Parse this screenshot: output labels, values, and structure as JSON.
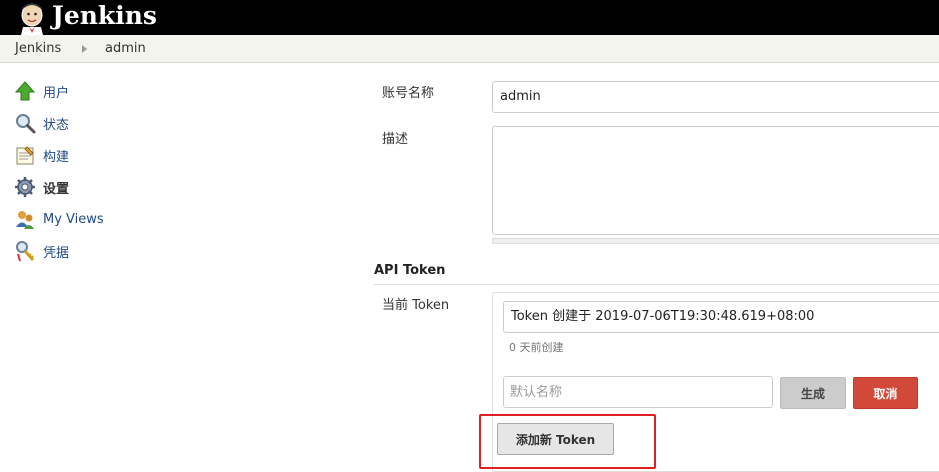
{
  "header": {
    "brand": "Jenkins",
    "logo_icon": "jenkins-butler-icon"
  },
  "breadcrumbs": [
    "Jenkins",
    "admin"
  ],
  "sidebar": {
    "items": [
      {
        "label": "用户",
        "icon": "up-arrow-icon"
      },
      {
        "label": "状态",
        "icon": "magnifier-icon"
      },
      {
        "label": "构建",
        "icon": "notepad-icon"
      },
      {
        "label": "设置",
        "icon": "gear-icon",
        "active": true
      },
      {
        "label": "My Views",
        "icon": "people-icon"
      },
      {
        "label": "凭据",
        "icon": "keys-icon"
      }
    ]
  },
  "form": {
    "account_name_label": "账号名称",
    "account_name_value": "admin",
    "description_label": "描述",
    "description_value": ""
  },
  "api_token": {
    "section_title": "API Token",
    "current_label": "当前 Token",
    "token_text": "Token 创建于 2019-07-06T19:30:48.619+08:00",
    "token_age": "0 天前创建",
    "name_placeholder": "默认名称",
    "generate_label": "生成",
    "cancel_label": "取消",
    "add_label": "添加新 Token"
  },
  "colors": {
    "header": "#000000",
    "link": "#204a87",
    "cancel": "#d24939",
    "highlight": "#e02020"
  }
}
